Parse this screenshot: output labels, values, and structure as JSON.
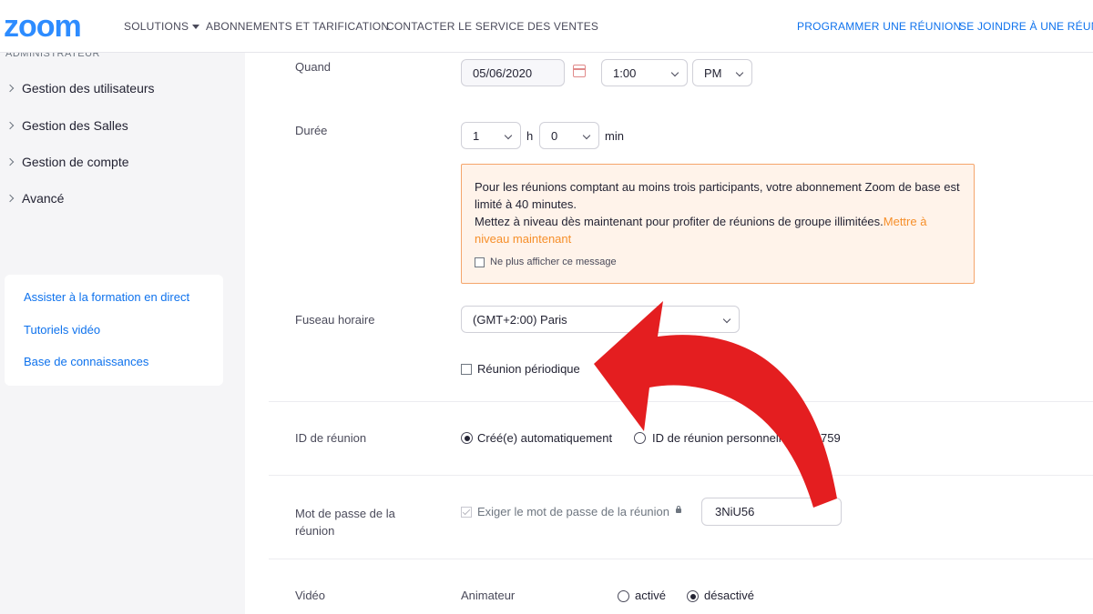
{
  "header": {
    "logo": "zoom",
    "nav": {
      "solutions": "SOLUTIONS",
      "pricing": "ABONNEMENTS ET TARIFICATION",
      "sales": "CONTACTER LE SERVICE DES VENTES",
      "schedule": "PROGRAMMER UNE RÉUNION",
      "join": "SE JOINDRE À UNE RÉUNION"
    }
  },
  "sidebar": {
    "section_label": "ADMINISTRATEUR",
    "items": [
      {
        "label": "Gestion des utilisateurs"
      },
      {
        "label": "Gestion des Salles"
      },
      {
        "label": "Gestion de compte"
      },
      {
        "label": "Avancé"
      }
    ],
    "help_links": [
      {
        "label": "Assister à la formation en direct"
      },
      {
        "label": "Tutoriels vidéo"
      },
      {
        "label": "Base de connaissances"
      }
    ]
  },
  "form": {
    "when": {
      "label": "Quand",
      "date": "05/06/2020",
      "time": "1:00",
      "ampm": "PM"
    },
    "duration": {
      "label": "Durée",
      "hours": "1",
      "hours_unit": "h",
      "minutes": "0",
      "minutes_unit": "min"
    },
    "notice": {
      "line1": "Pour les réunions comptant au moins trois participants, votre abonnement Zoom de base est limité à 40 minutes.",
      "line2": "Mettez à niveau dès maintenant pour profiter de réunions de groupe illimitées.",
      "upgrade_link": "Mettre à niveau maintenant",
      "dismiss": "Ne plus afficher ce message"
    },
    "timezone": {
      "label": "Fuseau horaire",
      "value": "(GMT+2:00) Paris"
    },
    "recurring": {
      "label": "Réunion périodique"
    },
    "meeting_id": {
      "label": "ID de réunion",
      "option_auto": "Créé(e) automatiquement",
      "option_personal": "ID de réunion personnelle",
      "personal_id": "073 5759"
    },
    "password": {
      "label": "Mot de passe de la réunion",
      "require_label": "Exiger le mot de passe de la réunion",
      "value": "3NiU56"
    },
    "video": {
      "label": "Vidéo",
      "host_label": "Animateur",
      "on_label": "activé",
      "off_label": "désactivé"
    }
  },
  "colors": {
    "brand": "#2d8cff",
    "link": "#0e72ed",
    "warning_bg": "#fff3ea",
    "warning_border": "#f5a56b",
    "upgrade": "#f68f2a",
    "annotation_arrow": "#e41e20"
  }
}
